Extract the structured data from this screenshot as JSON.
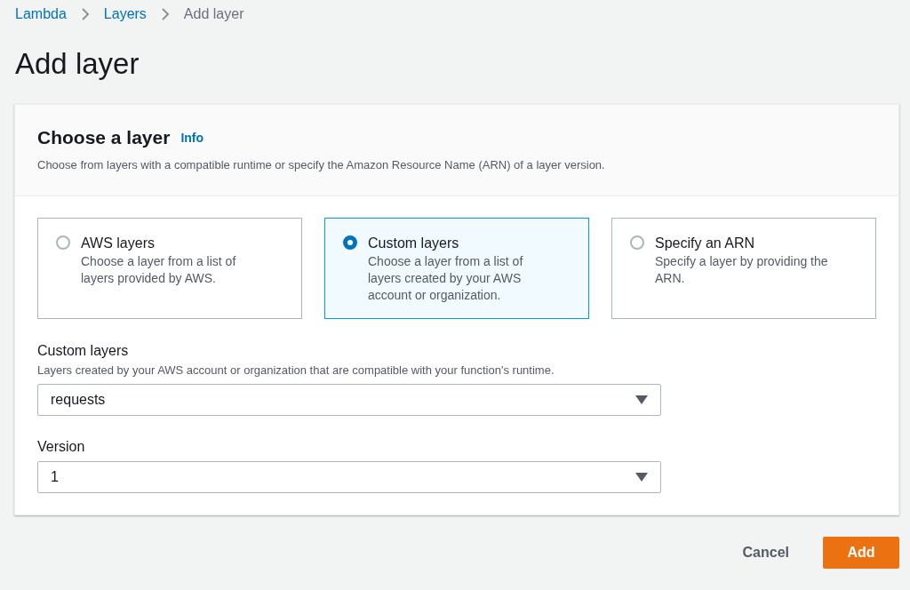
{
  "breadcrumbs": [
    {
      "label": "Lambda",
      "link": true
    },
    {
      "label": "Layers",
      "link": true
    },
    {
      "label": "Add layer",
      "link": false
    }
  ],
  "title": "Add layer",
  "panel": {
    "title": "Choose a layer",
    "info": "Info",
    "description": "Choose from layers with a compatible runtime or specify the Amazon Resource Name (ARN) of a layer version.",
    "options": [
      {
        "label": "AWS layers",
        "description": "Choose a layer from a list of layers provided by AWS.",
        "selected": false
      },
      {
        "label": "Custom layers",
        "description": "Choose a layer from a list of layers created by your AWS account or organization.",
        "selected": true
      },
      {
        "label": "Specify an ARN",
        "description": "Specify a layer by providing the ARN.",
        "selected": false
      }
    ],
    "fields": [
      {
        "label": "Custom layers",
        "description": "Layers created by your AWS account or organization that are compatible with your function's runtime.",
        "value": "requests"
      },
      {
        "label": "Version",
        "value": "1"
      }
    ]
  },
  "buttons": {
    "cancel": "Cancel",
    "add": "Add"
  }
}
